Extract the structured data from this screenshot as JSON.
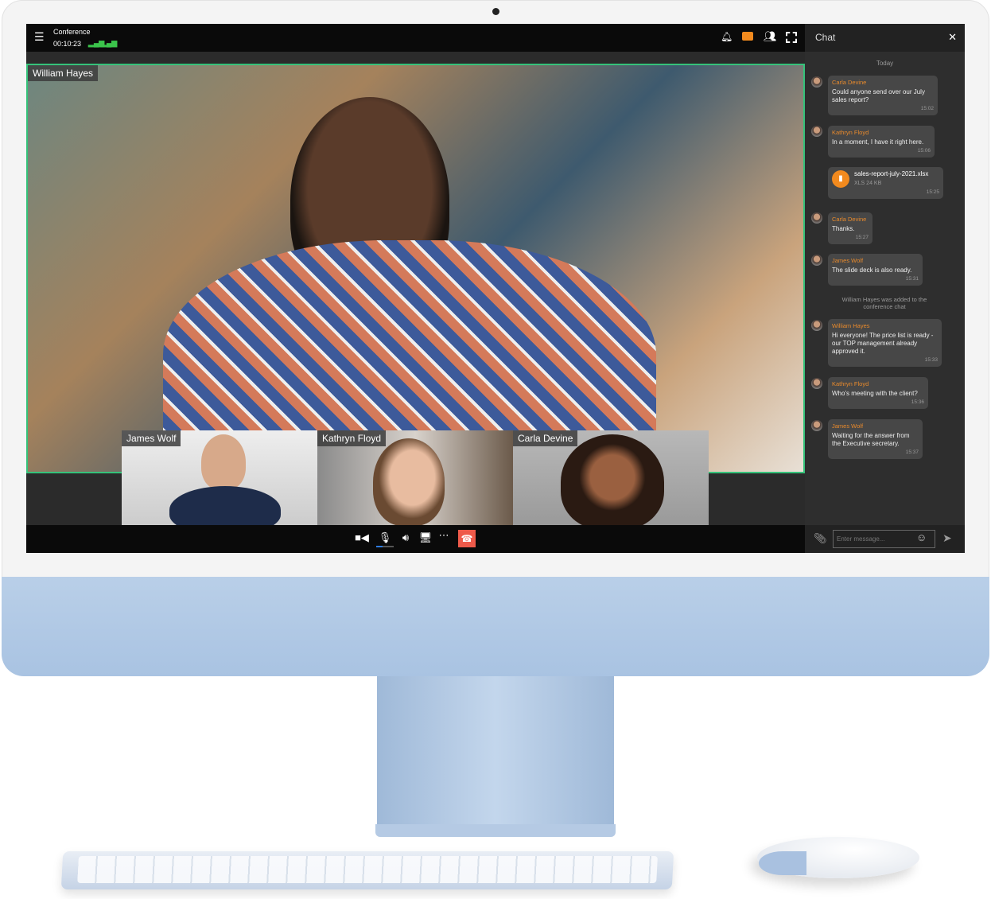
{
  "app": {
    "title": "Conference",
    "timer": "00:10:23",
    "accent": "#f28a1e",
    "speaker_border": "#35c27a"
  },
  "topbar_icons": [
    "menu-icon",
    "signal-icon",
    "signal-icon",
    "bell-icon",
    "chat-icon",
    "participants-icon",
    "fullscreen-icon"
  ],
  "main_speaker": {
    "name": "William Hayes"
  },
  "participants": [
    {
      "name": "James Wolf"
    },
    {
      "name": "Kathryn Floyd"
    },
    {
      "name": "Carla Devine"
    }
  ],
  "controls": [
    "camera-icon",
    "microphone-icon",
    "speaker-icon",
    "screen-share-icon",
    "more-icon",
    "hang-up-icon"
  ],
  "mic_level": 0.35,
  "chat": {
    "title": "Chat",
    "date_divider": "Today",
    "messages": [
      {
        "sender": "Carla Devine",
        "text": "Could anyone send over our  July sales report?",
        "time": "15:02"
      },
      {
        "sender": "Kathryn Floyd",
        "text": "In a moment, I have it right here.",
        "time": "15:06"
      },
      {
        "file_name": "sales-report-july-2021.xlsx",
        "file_meta": "XLS 24 KB",
        "time": "15:25"
      },
      {
        "sender": "Carla Devine",
        "text": "Thanks.",
        "time": "15:27"
      },
      {
        "sender": "James Wolf",
        "text": "The slide deck is also ready.",
        "time": "15:31"
      },
      {
        "sender": "William Hayes",
        "text": "Hi everyone! The price list is ready - our TOP management already approved it.",
        "time": "15:33"
      },
      {
        "sender": "Kathryn Floyd",
        "text": "Who's meeting with the client?",
        "time": "15:36"
      },
      {
        "sender": "James Wolf",
        "text": "Waiting for the answer from the Executive secretary.",
        "time": "15:37"
      }
    ],
    "system_message": "William Hayes was added to the conference chat",
    "input_placeholder": "Enter message..."
  }
}
